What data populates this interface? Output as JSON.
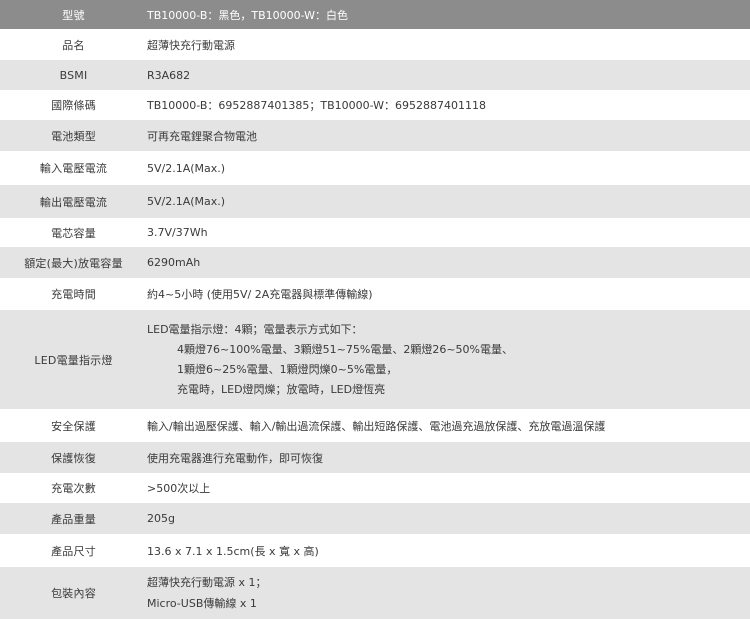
{
  "header": {
    "label": "型號",
    "value": "TB10000-B：黑色，TB10000-W：白色"
  },
  "rows": [
    {
      "label": "品名",
      "value": "超薄快充行動電源"
    },
    {
      "label": "BSMI",
      "value": "R3A682"
    },
    {
      "label": "國際條碼",
      "value": "TB10000-B：6952887401385；TB10000-W：6952887401118"
    },
    {
      "label": "電池類型",
      "value": "可再充電鋰聚合物電池"
    },
    {
      "label": "輸入電壓電流",
      "value": "5V/2.1A(Max.)"
    },
    {
      "label": "輸出電壓電流",
      "value": "5V/2.1A(Max.)"
    },
    {
      "label": "電芯容量",
      "value": "3.7V/37Wh"
    },
    {
      "label": "額定(最大)放電容量",
      "value": "6290mAh"
    },
    {
      "label": "充電時間",
      "value": "約4~5小時 (使用5V/ 2A充電器與標準傳輸線)"
    }
  ],
  "led": {
    "label": "LED電量指示燈",
    "lines": [
      "LED電量指示燈：4顆；電量表示方式如下：",
      "4顆燈76~100%電量、3顆燈51~75%電量、2顆燈26~50%電量、",
      "1顆燈6~25%電量、1顆燈閃爍0~5%電量，",
      "充電時，LED燈閃爍；放電時，LED燈恆亮"
    ]
  },
  "rows2": [
    {
      "label": "安全保護",
      "value": "輸入/輸出過壓保護、輸入/輸出過流保護、輸出短路保護、電池過充過放保護、充放電過溫保護"
    },
    {
      "label": "保護恢復",
      "value": "使用充電器進行充電動作，即可恢復"
    },
    {
      "label": "充電次數",
      "value": ">500次以上"
    },
    {
      "label": "產品重量",
      "value": "205g"
    },
    {
      "label": "產品尺寸",
      "value": "13.6 x 7.1 x 1.5cm(長 x 寬 x 高)"
    }
  ],
  "package": {
    "label": "包裝內容",
    "lines": [
      "超薄快充行動電源 x 1；",
      "Micro-USB傳輸線 x 1"
    ]
  }
}
